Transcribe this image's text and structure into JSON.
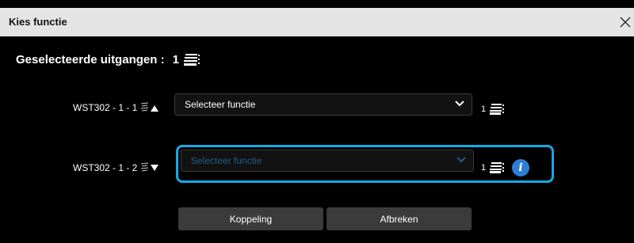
{
  "dialog": {
    "title": "Kies functie",
    "close_icon": "close-icon"
  },
  "summary": {
    "label": "Geselecteerde uitgangen :",
    "count": "1",
    "icon": "stack-icon"
  },
  "rows": [
    {
      "label": "WST302 - 1 - 1",
      "order_icon": "sort-up-icon",
      "select_value": "Selecteer functie",
      "count": "1",
      "count_icon": "stack-icon"
    },
    {
      "label": "WST302 - 1 - 2",
      "order_icon": "sort-down-icon",
      "select_placeholder": "Selecteer functie",
      "count": "1",
      "count_icon": "stack-icon",
      "info_icon": "info-icon"
    }
  ],
  "buttons": {
    "link": "Koppeling",
    "cancel": "Afbreken"
  },
  "colors": {
    "highlight": "#16a9e6",
    "info": "#2c7fd6",
    "titlebar": "#e4e4e4"
  }
}
